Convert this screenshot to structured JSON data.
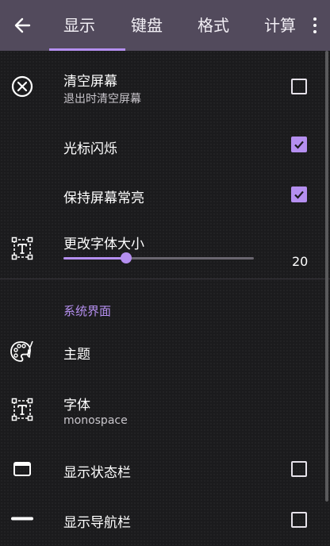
{
  "toolbar": {
    "tabs": [
      {
        "label": "显示",
        "selected": true
      },
      {
        "label": "键盘",
        "selected": false
      },
      {
        "label": "格式",
        "selected": false
      },
      {
        "label": "计算",
        "selected": false
      }
    ],
    "back_icon": "arrow-left-icon",
    "more_icon": "more-vert-icon"
  },
  "settings": {
    "clear_screen": {
      "title": "清空屏幕",
      "summary": "退出时清空屏幕",
      "checked": false,
      "icon": "close-circle-icon"
    },
    "cursor_blink": {
      "title": "光标闪烁",
      "checked": true
    },
    "keep_screen_on": {
      "title": "保持屏幕常亮",
      "checked": true
    },
    "font_size": {
      "title": "更改字体大小",
      "value": "20",
      "level_fraction": 0.33,
      "icon": "font-size-icon"
    }
  },
  "system_ui": {
    "category": "系统界面",
    "theme": {
      "title": "主题",
      "icon": "palette-icon"
    },
    "font": {
      "title": "字体",
      "summary": "monospace",
      "icon": "font-icon"
    },
    "status_bar": {
      "title": "显示状态栏",
      "checked": false,
      "icon": "window-icon"
    },
    "nav_bar": {
      "title": "显示导航栏",
      "checked": false,
      "icon": "nav-bar-icon"
    }
  },
  "colors": {
    "accent": "#b58ff0",
    "toolbar": "#524a5c",
    "background": "#1b1b1d"
  }
}
